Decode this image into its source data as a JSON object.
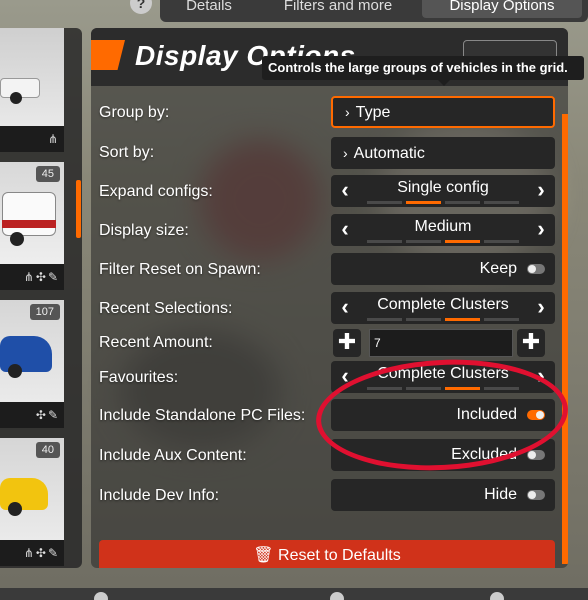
{
  "top_tabs": [
    "Details",
    "Filters and more",
    "Display Options"
  ],
  "active_tab": "Display Options",
  "panel": {
    "title": "Display Options",
    "tooltip": "Controls the large groups of vehicles in the grid."
  },
  "vehicles": [
    {
      "count": "",
      "color": "#eeeeee"
    },
    {
      "count": "45",
      "color": "#f2f2f2"
    },
    {
      "count": "107",
      "color": "#1f4fa8"
    },
    {
      "count": "40",
      "color": "#f2c40f"
    }
  ],
  "options": {
    "group_by": {
      "label": "Group by:",
      "value": "Type"
    },
    "sort_by": {
      "label": "Sort by:",
      "value": "Automatic"
    },
    "expand_configs": {
      "label": "Expand configs:",
      "value": "Single config"
    },
    "display_size": {
      "label": "Display size:",
      "value": "Medium"
    },
    "filter_reset": {
      "label": "Filter Reset on Spawn:",
      "value": "Keep",
      "on": false
    },
    "recent_selections": {
      "label": "Recent Selections:",
      "value": "Complete Clusters"
    },
    "recent_amount": {
      "label": "Recent Amount:",
      "value": "7"
    },
    "favourites": {
      "label": "Favourites:",
      "value": "Complete Clusters"
    },
    "standalone_pc": {
      "label": "Include Standalone PC Files:",
      "value": "Included",
      "on": true
    },
    "aux_content": {
      "label": "Include Aux Content:",
      "value": "Excluded",
      "on": false
    },
    "dev_info": {
      "label": "Include Dev Info:",
      "value": "Hide",
      "on": false
    }
  },
  "reset_label": "Reset to Defaults",
  "colors": {
    "accent": "#ff6a00",
    "reset": "#d0321a",
    "annotation": "#e01030"
  }
}
